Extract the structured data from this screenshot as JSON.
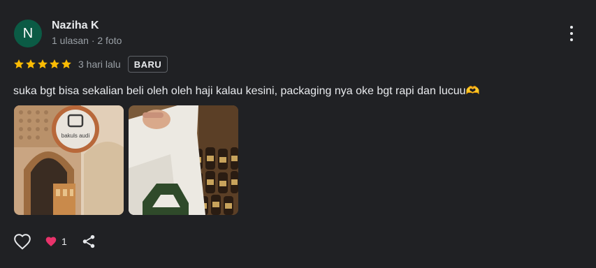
{
  "reviewer": {
    "initial": "N",
    "name": "Naziha K",
    "meta": "1 ulasan · 2 foto",
    "avatar_color": "#0b5b45"
  },
  "rating": {
    "stars": 5,
    "max": 5,
    "star_color": "#fbbc04"
  },
  "time": "3 hari lalu",
  "badge": "BARU",
  "review_text": "suka bgt bisa sekalian beli oleh oleh haji kalau kesini, packaging nya oke bgt rapi dan lucuu🫶",
  "photos": [
    {
      "description_icon": "store-photo",
      "sign_text": "bakuls audi"
    },
    {
      "description_icon": "bag-photo"
    }
  ],
  "actions": {
    "like_icon": "heart-outline-icon",
    "reaction_icon": "heart-filled-icon",
    "reaction_count": "1",
    "share_icon": "share-icon"
  }
}
